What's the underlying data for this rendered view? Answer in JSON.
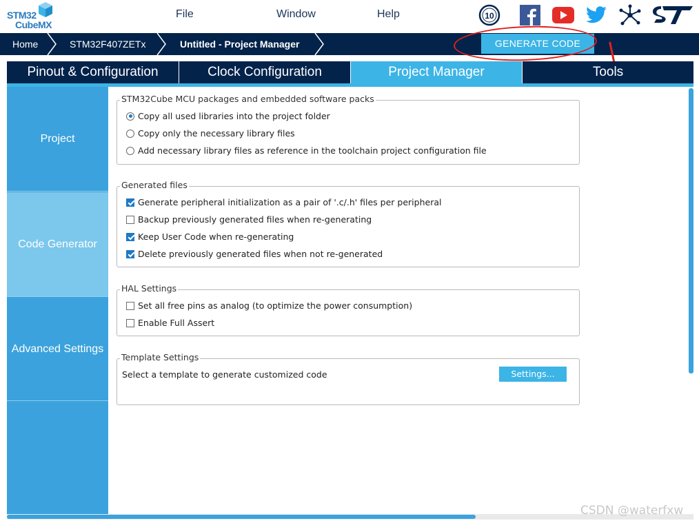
{
  "app": {
    "logo_line1": "STM32",
    "logo_line2": "CubeMX"
  },
  "menu": {
    "file": "File",
    "window": "Window",
    "help": "Help"
  },
  "social_icons": [
    "anniversary-10-icon",
    "facebook-icon",
    "youtube-icon",
    "twitter-icon",
    "network-icon",
    "st-logo-icon"
  ],
  "badge_text": "10",
  "breadcrumb": {
    "home": "Home",
    "mcu": "STM32F407ZETx",
    "project": "Untitled - Project Manager"
  },
  "generate_button": "GENERATE CODE",
  "tabs": [
    {
      "label": "Pinout & Configuration",
      "active": false
    },
    {
      "label": "Clock Configuration",
      "active": false
    },
    {
      "label": "Project Manager",
      "active": true
    },
    {
      "label": "Tools",
      "active": false
    }
  ],
  "sidebar": {
    "items": [
      {
        "label": "Project",
        "active": false
      },
      {
        "label": "Code Generator",
        "active": true
      },
      {
        "label": "Advanced Settings",
        "active": false
      }
    ]
  },
  "packages": {
    "title": "STM32Cube MCU packages and embedded software packs",
    "options": [
      {
        "label": "Copy all used libraries into the project folder",
        "selected": true
      },
      {
        "label": "Copy only the necessary library files",
        "selected": false
      },
      {
        "label": "Add necessary library files as reference in the toolchain project configuration file",
        "selected": false
      }
    ]
  },
  "generated_files": {
    "title": "Generated files",
    "options": [
      {
        "label": "Generate peripheral initialization as a pair of '.c/.h' files per peripheral",
        "checked": true
      },
      {
        "label": "Backup previously generated files when re-generating",
        "checked": false
      },
      {
        "label": "Keep User Code when re-generating",
        "checked": true
      },
      {
        "label": "Delete previously generated files when not re-generated",
        "checked": true
      }
    ]
  },
  "hal_settings": {
    "title": "HAL Settings",
    "options": [
      {
        "label": "Set all free pins as analog (to optimize the power consumption)",
        "checked": false
      },
      {
        "label": "Enable Full Assert",
        "checked": false
      }
    ]
  },
  "template_settings": {
    "title": "Template Settings",
    "description": "Select a template to generate customized code",
    "button": "Settings..."
  },
  "watermark": "CSDN @waterfxw",
  "colors": {
    "navy": "#03234b",
    "accent": "#3cb4e6",
    "sidebar": "#3ba2dd",
    "annotation_red": "#e0201e"
  }
}
